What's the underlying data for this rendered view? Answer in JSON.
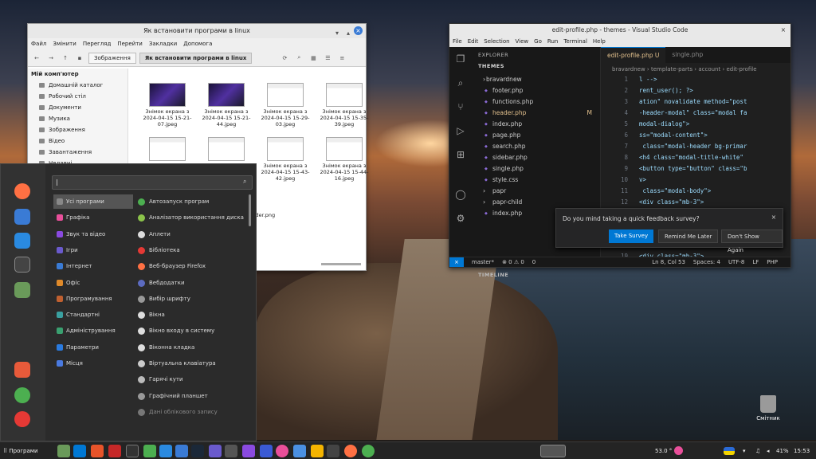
{
  "file_manager": {
    "title": "Як встановити програми в linux",
    "menu": [
      "Файл",
      "Змінити",
      "Перегляд",
      "Перейти",
      "Закладки",
      "Допомога"
    ],
    "breadcrumb": [
      "Зображення",
      "Як встановити програми в linux"
    ],
    "sidebar_header": "Мій комп'ютер",
    "sidebar": [
      "Домашній каталог",
      "Робочий стіл",
      "Документи",
      "Музика",
      "Зображення",
      "Відео",
      "Завантаження",
      "Недавні"
    ],
    "files": [
      {
        "name": "Знімок екрана з 2024-04-15 15-21-07.jpeg",
        "kind": "dark"
      },
      {
        "name": "Знімок екрана з 2024-04-15 15-21-44.jpeg",
        "kind": "dark"
      },
      {
        "name": "Знімок екрана з 2024-04-15 15-29-03.jpeg",
        "kind": "light"
      },
      {
        "name": "Знімок екрана з 2024-04-15 15-35-39.jpeg",
        "kind": "light"
      },
      {
        "name": "Знімок екрана з",
        "kind": "light"
      },
      {
        "name": "Знімок екрана з",
        "kind": "light"
      },
      {
        "name": "Знімок екрана з 2024-04-15 15-43-42.jpeg",
        "kind": "light"
      },
      {
        "name": "Знімок екрана з 2024-04-15 15-44-16.jpeg",
        "kind": "light"
      },
      {
        "name": "arrow.jpn",
        "kind": "arr"
      },
      {
        "name": "DriveCollaborationHeader.png",
        "kind": "drv"
      }
    ]
  },
  "vscode": {
    "title": "edit-profile.php - themes - Visual Studio Code",
    "menu": [
      "File",
      "Edit",
      "Selection",
      "View",
      "Go",
      "Run",
      "Terminal",
      "Help"
    ],
    "explorer_label": "EXPLORER",
    "themes_label": "THEMES",
    "tree": [
      {
        "name": "bravardnew",
        "folder": true
      },
      {
        "name": "footer.php"
      },
      {
        "name": "functions.php"
      },
      {
        "name": "header.php",
        "mark": "M",
        "sel": true
      },
      {
        "name": "index.php"
      },
      {
        "name": "page.php"
      },
      {
        "name": "search.php"
      },
      {
        "name": "sidebar.php"
      },
      {
        "name": "single.php"
      },
      {
        "name": "style.css"
      },
      {
        "name": "papr",
        "folder": true
      },
      {
        "name": "papr-child",
        "folder": true
      },
      {
        "name": "index.php"
      }
    ],
    "outline": "OUTLINE",
    "timeline": "TIMELINE",
    "tabs": [
      "edit-profile.php U",
      "single.php"
    ],
    "breadcrumb": "bravardnew › template-parts › account › edit-profile",
    "code": [
      {
        "n": "1",
        "t": "l -->"
      },
      {
        "n": "2",
        "t": "rent_user(); ?>"
      },
      {
        "n": "3",
        "t": "ation\" novalidate method=\"post"
      },
      {
        "n": "4",
        "t": "-header-modal\" class=\"modal fa"
      },
      {
        "n": "5",
        "t": "modal-dialog\">"
      },
      {
        "n": "6",
        "t": "ss=\"modal-content\">"
      },
      {
        "n": "7",
        "t": " class=\"modal-header bg-primar"
      },
      {
        "n": "8",
        "t": "<h4 class=\"modal-title-white\""
      },
      {
        "n": "9",
        "t": "<button type=\"button\" class=\"b"
      },
      {
        "n": "10",
        "t": "v>"
      },
      {
        "n": "11",
        "t": " class=\"modal-body\">"
      },
      {
        "n": "12",
        "t": "<div class=\"mb-3\">"
      },
      {
        "n": "13",
        "t": "    <label class=\"form-label\""
      },
      {
        "n": "14",
        "t": "    <input type=\"text\" class="
      },
      {
        "n": "19",
        "t": "<div class=\"mb-3\">"
      }
    ],
    "notification": {
      "question": "Do you mind taking a quick feedback survey?",
      "take": "Take Survey",
      "later": "Remind Me Later",
      "never": "Don't Show Again"
    },
    "status": {
      "branch": "master*",
      "errors": "⊗ 0 ⚠ 0",
      "ports": "0",
      "pos": "Ln 8, Col 53",
      "spaces": "Spaces: 4",
      "enc": "UTF-8",
      "eol": "LF",
      "lang": "PHP"
    }
  },
  "app_menu": {
    "search_value": "|",
    "categories": [
      {
        "label": "Усі програми",
        "color": "#888",
        "on": true
      },
      {
        "label": "Графіка",
        "color": "#e94f9a"
      },
      {
        "label": "Звук та відео",
        "color": "#8a4ae0"
      },
      {
        "label": "Ігри",
        "color": "#6a5acd"
      },
      {
        "label": "Інтернет",
        "color": "#3a7bd5"
      },
      {
        "label": "Офіс",
        "color": "#e08a2a"
      },
      {
        "label": "Програмування",
        "color": "#c06030"
      },
      {
        "label": "Стандартні",
        "color": "#3aa0a0"
      },
      {
        "label": "Адміністрування",
        "color": "#3aa070"
      },
      {
        "label": "Параметри",
        "color": "#2a7be0"
      },
      {
        "label": "Місця",
        "color": "#4a7ae0"
      }
    ],
    "apps": [
      {
        "label": "Автозапуск програм",
        "color": "#4caf50"
      },
      {
        "label": "Аналізатор використання диска",
        "color": "#8bc34a"
      },
      {
        "label": "Аплети",
        "color": "#ddd"
      },
      {
        "label": "Бібліотека",
        "color": "#e53935"
      },
      {
        "label": "Веб-браузер Firefox",
        "color": "#ff7043"
      },
      {
        "label": "Вебдодатки",
        "color": "#5c6bc0"
      },
      {
        "label": "Вибір шрифту",
        "color": "#999"
      },
      {
        "label": "Вікна",
        "color": "#ddd"
      },
      {
        "label": "Вікно входу в систему",
        "color": "#ddd"
      },
      {
        "label": "Віконна кладка",
        "color": "#ddd"
      },
      {
        "label": "Віртуальна клавіатура",
        "color": "#ccc"
      },
      {
        "label": "Гарячі кути",
        "color": "#bbb"
      },
      {
        "label": "Графічний планшет",
        "color": "#999"
      },
      {
        "label": "Дані облікового запису",
        "color": "#777",
        "dim": true
      }
    ]
  },
  "taskbar": {
    "start": "Програми",
    "tray_temp": "53.0 °",
    "battery": "41%",
    "time": "15:53"
  },
  "desktop": {
    "trash": "Смітник"
  }
}
